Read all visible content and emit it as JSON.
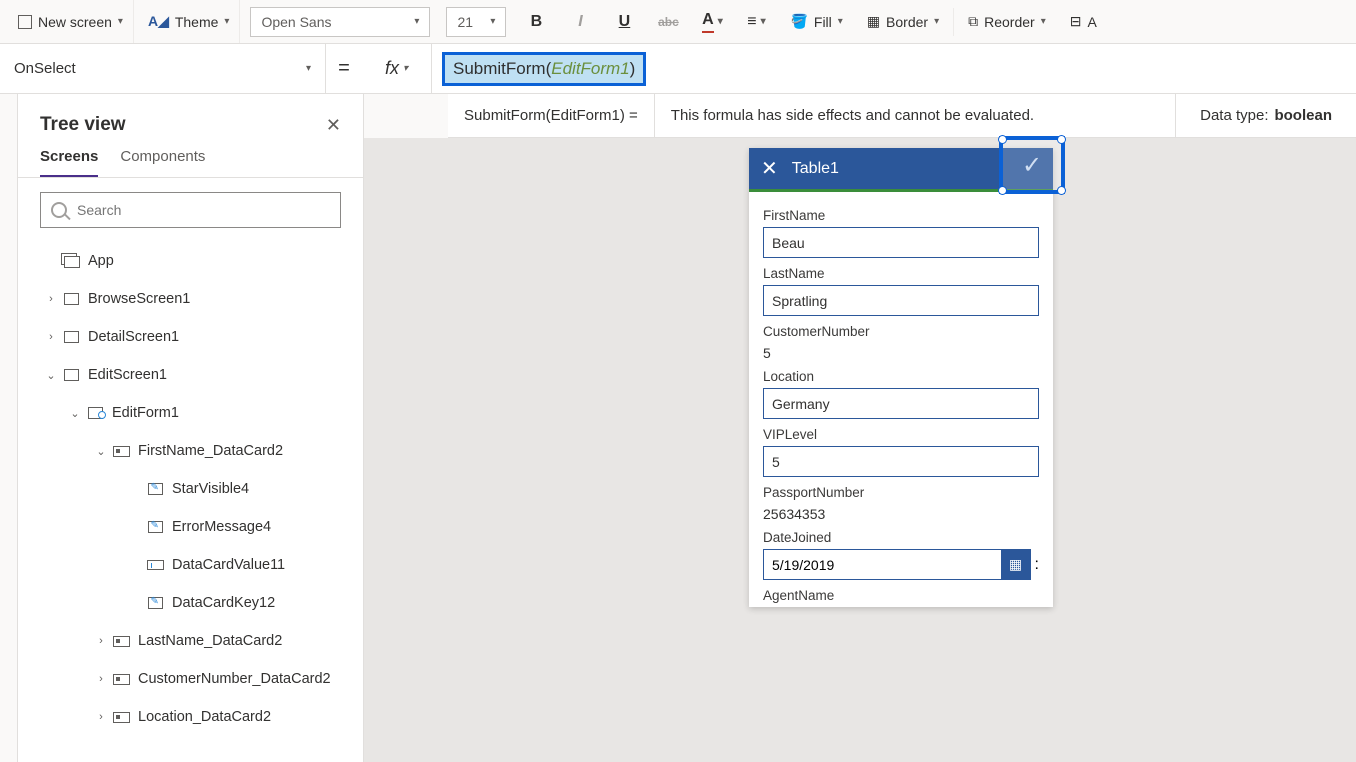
{
  "toolbar": {
    "new_screen": "New screen",
    "theme": "Theme",
    "font": "Open Sans",
    "font_size": "21",
    "fill": "Fill",
    "border": "Border",
    "reorder": "Reorder",
    "align": "A"
  },
  "formula": {
    "property": "OnSelect",
    "fx": "fx",
    "fn_name": "SubmitForm",
    "fn_arg": "EditForm1",
    "result_lhs": "SubmitForm(EditForm1)  =",
    "result_rhs": "This formula has side effects and cannot be evaluated.",
    "datatype_label": "Data type:",
    "datatype_value": "boolean"
  },
  "tree": {
    "title": "Tree view",
    "tabs": {
      "screens": "Screens",
      "components": "Components"
    },
    "search_placeholder": "Search",
    "app": "App",
    "browse": "BrowseScreen1",
    "detail": "DetailScreen1",
    "edit": "EditScreen1",
    "editform": "EditForm1",
    "fn_card": "FirstName_DataCard2",
    "star": "StarVisible4",
    "err": "ErrorMessage4",
    "val": "DataCardValue11",
    "key": "DataCardKey12",
    "ln_card": "LastName_DataCard2",
    "cn_card": "CustomerNumber_DataCard2",
    "loc_card": "Location_DataCard2"
  },
  "form": {
    "title": "Table1",
    "fields": {
      "firstname_label": "FirstName",
      "firstname_value": "Beau",
      "lastname_label": "LastName",
      "lastname_value": "Spratling",
      "custnum_label": "CustomerNumber",
      "custnum_value": "5",
      "location_label": "Location",
      "location_value": "Germany",
      "vip_label": "VIPLevel",
      "vip_value": "5",
      "passport_label": "PassportNumber",
      "passport_value": "25634353",
      "date_label": "DateJoined",
      "date_value": "5/19/2019",
      "agent_label": "AgentName"
    }
  }
}
